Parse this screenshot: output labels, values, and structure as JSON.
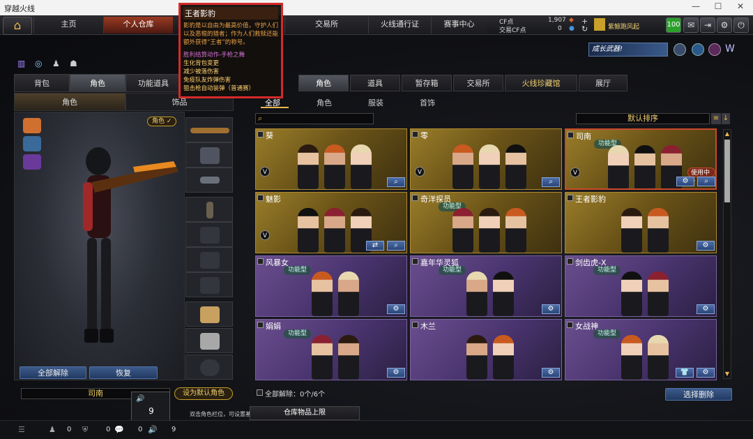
{
  "window": {
    "title": "穿越火线"
  },
  "nav": {
    "tabs": [
      {
        "label": "主页"
      },
      {
        "label": "个人仓库"
      },
      {
        "label": "交易所"
      },
      {
        "label": "火线通行证"
      },
      {
        "label": "赛事中心"
      }
    ],
    "cf_label": "CF点",
    "cf_value": "1,907",
    "cfs_label": "交易CF点",
    "cfs_value": "0",
    "player_name": "紫鲸跑风起",
    "badge_level": "100"
  },
  "promo": {
    "text": "成长武器!"
  },
  "left": {
    "tabs": [
      "背包",
      "角色",
      "功能道具"
    ],
    "subtabs": [
      "角色",
      "饰品"
    ],
    "role_badge": "角色 ✓",
    "unequip_all": "全部解除",
    "restore": "恢复",
    "character_name": "司南",
    "set_default": "设为默认角色",
    "hint": "双击角色栏位，可设置基",
    "warehouse_limit": "仓库物品上限",
    "volume": "9"
  },
  "right": {
    "tabs": [
      "角色",
      "道具",
      "暂存箱",
      "交易所",
      "火线珍藏馆",
      "展厅"
    ],
    "filters": [
      "全部",
      "角色",
      "服装",
      "首饰"
    ],
    "sort_label": "默认排序",
    "cards": [
      {
        "name": "葵",
        "style": "gold",
        "tag": "",
        "in_use": false,
        "buttons": [
          "search"
        ]
      },
      {
        "name": "零",
        "style": "gold",
        "tag": "",
        "in_use": false,
        "buttons": [
          "search"
        ]
      },
      {
        "name": "司南",
        "style": "gold",
        "tag": "功能型",
        "in_use": true,
        "in_use_label": "使用中✓",
        "buttons": [
          "gift",
          "search"
        ]
      },
      {
        "name": "魅影",
        "style": "gold",
        "tag": "",
        "in_use": false,
        "buttons": [
          "swap",
          "search"
        ]
      },
      {
        "name": "奇洋探员",
        "style": "gold",
        "tag": "功能型",
        "in_use": false,
        "buttons": []
      },
      {
        "name": "王者影豹",
        "style": "gold",
        "tag": "",
        "in_use": false,
        "buttons": [
          "gift"
        ]
      },
      {
        "name": "风暴女",
        "style": "purple",
        "tag": "功能型",
        "in_use": false,
        "buttons": [
          "gift"
        ]
      },
      {
        "name": "嘉年华灵狐",
        "style": "purple",
        "tag": "功能型",
        "in_use": false,
        "buttons": [
          "gift"
        ]
      },
      {
        "name": "剑齿虎-X",
        "style": "purple",
        "tag": "功能型",
        "in_use": false,
        "buttons": [
          "gift"
        ]
      },
      {
        "name": "娟娟",
        "style": "purple",
        "tag": "功能型",
        "in_use": false,
        "buttons": [
          "gift"
        ]
      },
      {
        "name": "木兰",
        "style": "purple",
        "tag": "",
        "in_use": false,
        "buttons": [
          "gift"
        ]
      },
      {
        "name": "女战神",
        "style": "purple",
        "tag": "功能型",
        "in_use": false,
        "buttons": [
          "shirt",
          "gift"
        ]
      }
    ],
    "unequip_count": "全部解除：0个/6个",
    "select_delete": "选择删除"
  },
  "tooltip": {
    "title": "王者影豹",
    "desc": "影豹是以自由为最高价值，守护人们以及恶棍的猎者；作为人们救赎还能额外获得“王者”的称号。",
    "features": [
      "胜利结算动作-手枪之舞",
      "生化背包变更",
      "减少被落伤害",
      "免疫队友炸弹伤害",
      "狙击枪自动装弹（普通赛）"
    ]
  },
  "statusbar": {
    "counts": [
      "0",
      "0",
      "0",
      "9"
    ]
  }
}
